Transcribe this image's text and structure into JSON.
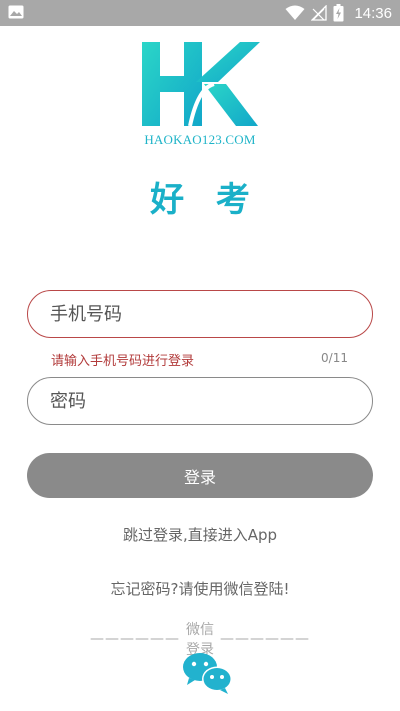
{
  "status_bar": {
    "time": "14:36",
    "icons": [
      "image-icon",
      "wifi-icon",
      "signal-icon",
      "battery-charging-icon"
    ]
  },
  "logo": {
    "letters": "HK",
    "site": "HAOKAO123.COM"
  },
  "brand": {
    "name": "好 考"
  },
  "form": {
    "phone_placeholder": "手机号码",
    "phone_error": "请输入手机号码进行登录",
    "phone_counter": "0/11",
    "password_placeholder": "密码",
    "login_label": "登录"
  },
  "links": {
    "skip": "跳过登录,直接进入App",
    "forgot": "忘记密码?请使用微信登陆!"
  },
  "wechat": {
    "divider_left": "——————",
    "divider_label": "微信登录",
    "divider_right": "——————"
  },
  "colors": {
    "brand": "#1ab0c8",
    "error": "#b23b3b",
    "button": "#8a8a8a",
    "status_bar": "#a8a8a8"
  }
}
